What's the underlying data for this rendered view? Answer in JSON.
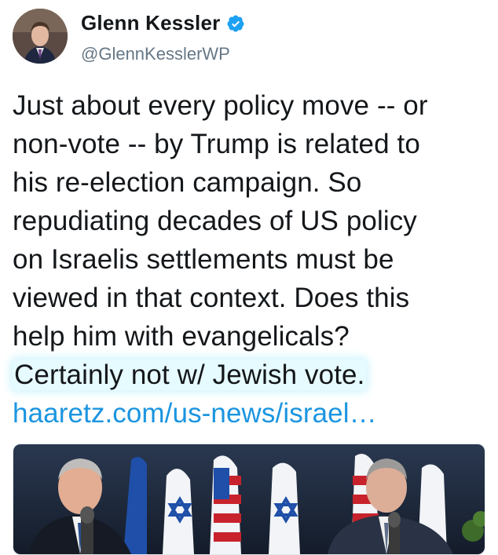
{
  "author": {
    "name": "Glenn Kessler",
    "handle": "@GlennKesslerWP",
    "verified": true,
    "avatar_icon": "profile-photo"
  },
  "tweet": {
    "lines": [
      "Just about every policy move -- or",
      "non-vote -- by Trump is related to",
      "his re-election campaign. So",
      "repudiating decades of US policy",
      "on Israelis settlements must be",
      "viewed in that context. Does this",
      "help him with evangelicals?"
    ],
    "highlighted_line": "Certainly not w/ Jewish vote.",
    "link_text": "haaretz.com/us-news/israel…"
  },
  "media": {
    "icon": "news-photo",
    "colors": {
      "flag_blue": "#1f4fa8",
      "flag_red": "#c8232c",
      "background": "#1a2536"
    }
  },
  "colors": {
    "link": "#1b95e0",
    "text": "#14171a",
    "muted": "#657786",
    "highlight": "#e6fbff"
  }
}
